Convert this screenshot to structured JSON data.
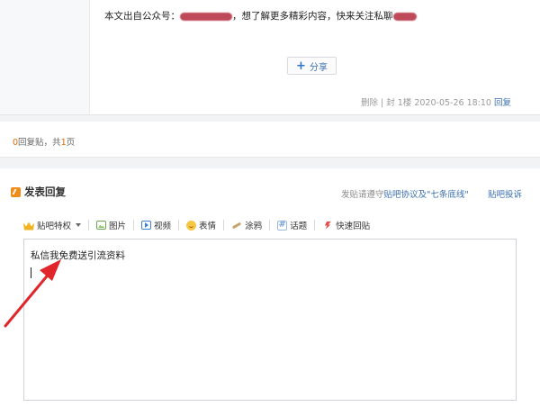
{
  "post": {
    "text_prefix": "本文出自公众号：",
    "text_middle": "，想了解更多精彩内容，快来关注私聊",
    "share_label": "分享",
    "delete_label": "删除",
    "meta_sep": "|",
    "report_label": "封",
    "floor": "1楼",
    "timestamp": "2020-05-26 18:10",
    "reply_link": "回复"
  },
  "reply_summary": {
    "count": "0",
    "mid_text": "回复贴，共",
    "pages": "1",
    "suffix": "页"
  },
  "reply_panel": {
    "title": "发表回复",
    "rules_prefix": "发贴请遵守",
    "rules_link": "贴吧协议及\"七条底线\"",
    "complaint_link": "贴吧投诉"
  },
  "toolbar": {
    "items": [
      {
        "label": "贴吧特权",
        "icon": "crown-icon"
      },
      {
        "label": "图片",
        "icon": "image-icon"
      },
      {
        "label": "视频",
        "icon": "video-icon"
      },
      {
        "label": "表情",
        "icon": "smile-icon"
      },
      {
        "label": "涂鸦",
        "icon": "brush-icon"
      },
      {
        "label": "话题",
        "icon": "hash-icon"
      },
      {
        "label": "快速回贴",
        "icon": "fast-reply-icon"
      }
    ]
  },
  "editor": {
    "content": "私信我免费送引流资料"
  },
  "colors": {
    "link": "#3a6fb0",
    "count_orange": "#e36a00",
    "arrow_red": "#e0262b",
    "redaction": "#b32b3d"
  }
}
